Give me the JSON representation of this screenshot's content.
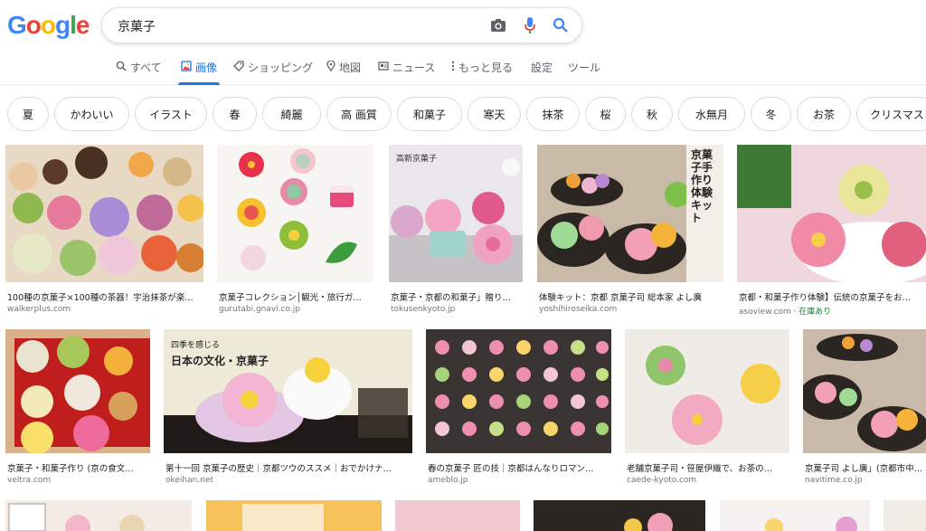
{
  "logo": "Google",
  "search": {
    "query": "京菓子"
  },
  "tabs": [
    {
      "label": "すべて"
    },
    {
      "label": "画像"
    },
    {
      "label": "ショッピング"
    },
    {
      "label": "地図"
    },
    {
      "label": "ニュース"
    },
    {
      "label": "もっと見る"
    },
    {
      "label": "設定"
    },
    {
      "label": "ツール"
    }
  ],
  "chips": [
    "夏",
    "かわいい",
    "イラスト",
    "春",
    "綺麗",
    "高 画質",
    "和菓子",
    "寒天",
    "抹茶",
    "桜",
    "秋",
    "水無月",
    "冬",
    "お茶",
    "クリスマス"
  ],
  "results": [
    {
      "caption": "100種の京菓子×100種の茶器！宇治抹茶が楽…",
      "source": "walkerplus.com"
    },
    {
      "caption": "京菓子コレクション│観光・旅行ガ…",
      "source": "gurutabi.gnavi.co.jp"
    },
    {
      "caption": "京菓子・京都の和菓子」贈り…",
      "source": "tokusenkyoto.jp"
    },
    {
      "caption": "体験キット：京都 京菓子司 総本家 よし廣",
      "source": "yoshihiroseika.com"
    },
    {
      "caption": "京都・和菓子作り体験】伝統の京菓子をお…",
      "source": "asoview.com",
      "source_extra": "· 在庫あり"
    },
    {
      "caption": "京菓子・和菓子作り (京の食文…",
      "source": "veltra.com"
    },
    {
      "caption": "第十一回 京菓子の歴史｜京都ツウのススメ｜おでかけナ…",
      "source": "okeihan.net"
    },
    {
      "caption": "春の京菓子 匠の技｜京都はんなりロマン…",
      "source": "ameblo.jp"
    },
    {
      "caption": "老舗京菓子司・笹屋伊織で、お茶の…",
      "source": "caede-kyoto.com"
    },
    {
      "caption": "京菓子司 よし廣」(京都市中京…",
      "source": "navitime.co.jp"
    }
  ],
  "image_text": {
    "r1_3": "高新京菓子",
    "r1_4": "京菓子手作り体験キット",
    "r2_2_a": "四季を感じる",
    "r2_2_b": "日本の文化・京菓子"
  },
  "colors": {
    "accent": "#1a73e8",
    "link_green": "#188038"
  }
}
